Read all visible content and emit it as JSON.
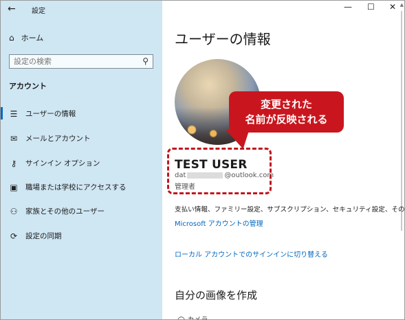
{
  "window": {
    "back_icon": "←",
    "title": "設定",
    "minimize_icon": "—",
    "maximize_icon": "☐",
    "close_icon": "✕"
  },
  "sidebar": {
    "home_label": "ホーム",
    "search_placeholder": "設定の検索",
    "section_label": "アカウント",
    "items": [
      {
        "label": "ユーザーの情報",
        "icon": "user-info-icon",
        "glyph": "☰"
      },
      {
        "label": "メールとアカウント",
        "icon": "mail-icon",
        "glyph": "✉"
      },
      {
        "label": "サインイン オプション",
        "icon": "key-icon",
        "glyph": "⚷"
      },
      {
        "label": "職場または学校にアクセスする",
        "icon": "briefcase-icon",
        "glyph": "▣"
      },
      {
        "label": "家族とその他のユーザー",
        "icon": "person-add-icon",
        "glyph": "⚇"
      },
      {
        "label": "設定の同期",
        "icon": "sync-icon",
        "glyph": "⟳"
      }
    ]
  },
  "main": {
    "page_title": "ユーザーの情報",
    "user": {
      "name": "TEST USER",
      "email_prefix": "dat",
      "email_suffix": "@outlook.com",
      "role": "管理者"
    },
    "callout": {
      "line1": "変更された",
      "line2": "名前が反映される"
    },
    "info_text": "支払い情報、ファミリー設定、サブスクリプション、セキュリティ設定、その他",
    "manage_link": "Microsoft アカウントの管理",
    "local_link": "ローカル アカウントでのサインインに切り替える",
    "create_section": "自分の画像を作成"
  },
  "colors": {
    "sidebar_bg": "#cfe6f3",
    "accent": "#0067c0",
    "callout_red": "#c9161e"
  }
}
